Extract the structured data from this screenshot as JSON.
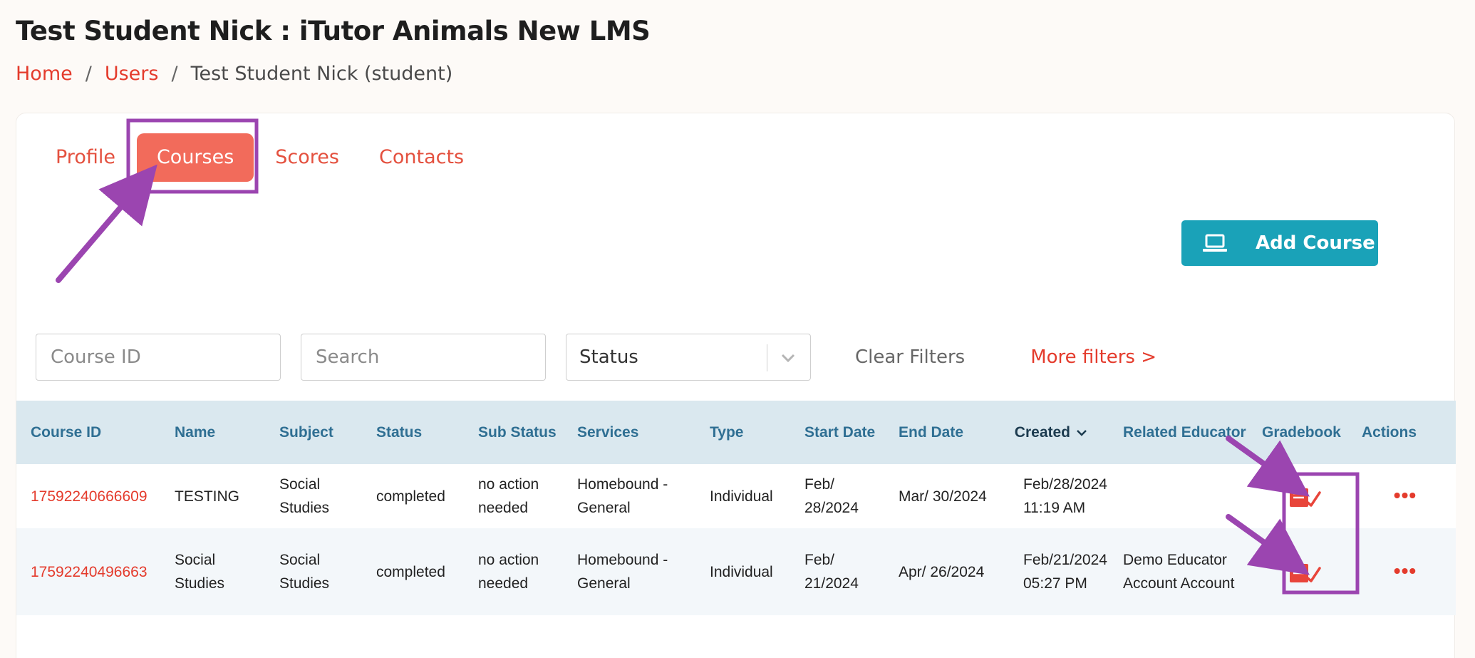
{
  "header": {
    "title": "Test Student Nick : iTutor Animals New LMS",
    "breadcrumb": [
      {
        "label": "Home"
      },
      {
        "label": "Users"
      },
      {
        "label": "Test Student Nick (student)"
      }
    ],
    "breadcrumb_separator": "/"
  },
  "tabs": [
    {
      "label": "Profile",
      "active": false
    },
    {
      "label": "Courses",
      "active": true
    },
    {
      "label": "Scores",
      "active": false
    },
    {
      "label": "Contacts",
      "active": false
    }
  ],
  "actions": {
    "add_course_label": "Add Course",
    "add_course_icon": "laptop-icon"
  },
  "filters": {
    "course_id_placeholder": "Course ID",
    "search_placeholder": "Search",
    "status_placeholder": "Status",
    "clear_label": "Clear Filters",
    "more_label": "More filters >"
  },
  "table": {
    "columns": [
      "Course ID",
      "Name",
      "Subject",
      "Status",
      "Sub Status",
      "Services",
      "Type",
      "Start Date",
      "End Date",
      "Created",
      "Related Educator",
      "Gradebook",
      "Actions"
    ],
    "sorted_column": "Created",
    "rows": [
      {
        "course_id": "17592240666609",
        "name": "TESTING",
        "subject": "Social Studies",
        "status": "completed",
        "sub_status": "no action needed",
        "services": "Homebound - General",
        "type": "Individual",
        "start_date": "Feb/ 28/2024",
        "end_date": "Mar/ 30/2024",
        "created": "Feb/28/2024 11:19 AM",
        "related_educator": "",
        "actions": "•••"
      },
      {
        "course_id": "17592240496663",
        "name": "Social Studies",
        "subject": "Social Studies",
        "status": "completed",
        "sub_status": "no action needed",
        "services": "Homebound - General",
        "type": "Individual",
        "start_date": "Feb/ 21/2024",
        "end_date": "Apr/ 26/2024",
        "created": "Feb/21/2024 05:27 PM",
        "related_educator": "Demo Educator Account Account",
        "actions": "•••"
      }
    ]
  },
  "colors": {
    "accent": "#e43b2c",
    "active_tab": "#f26b5b",
    "add_button": "#1aa2b8",
    "table_header": "#dae8ef",
    "annotation": "#9b45b0"
  }
}
